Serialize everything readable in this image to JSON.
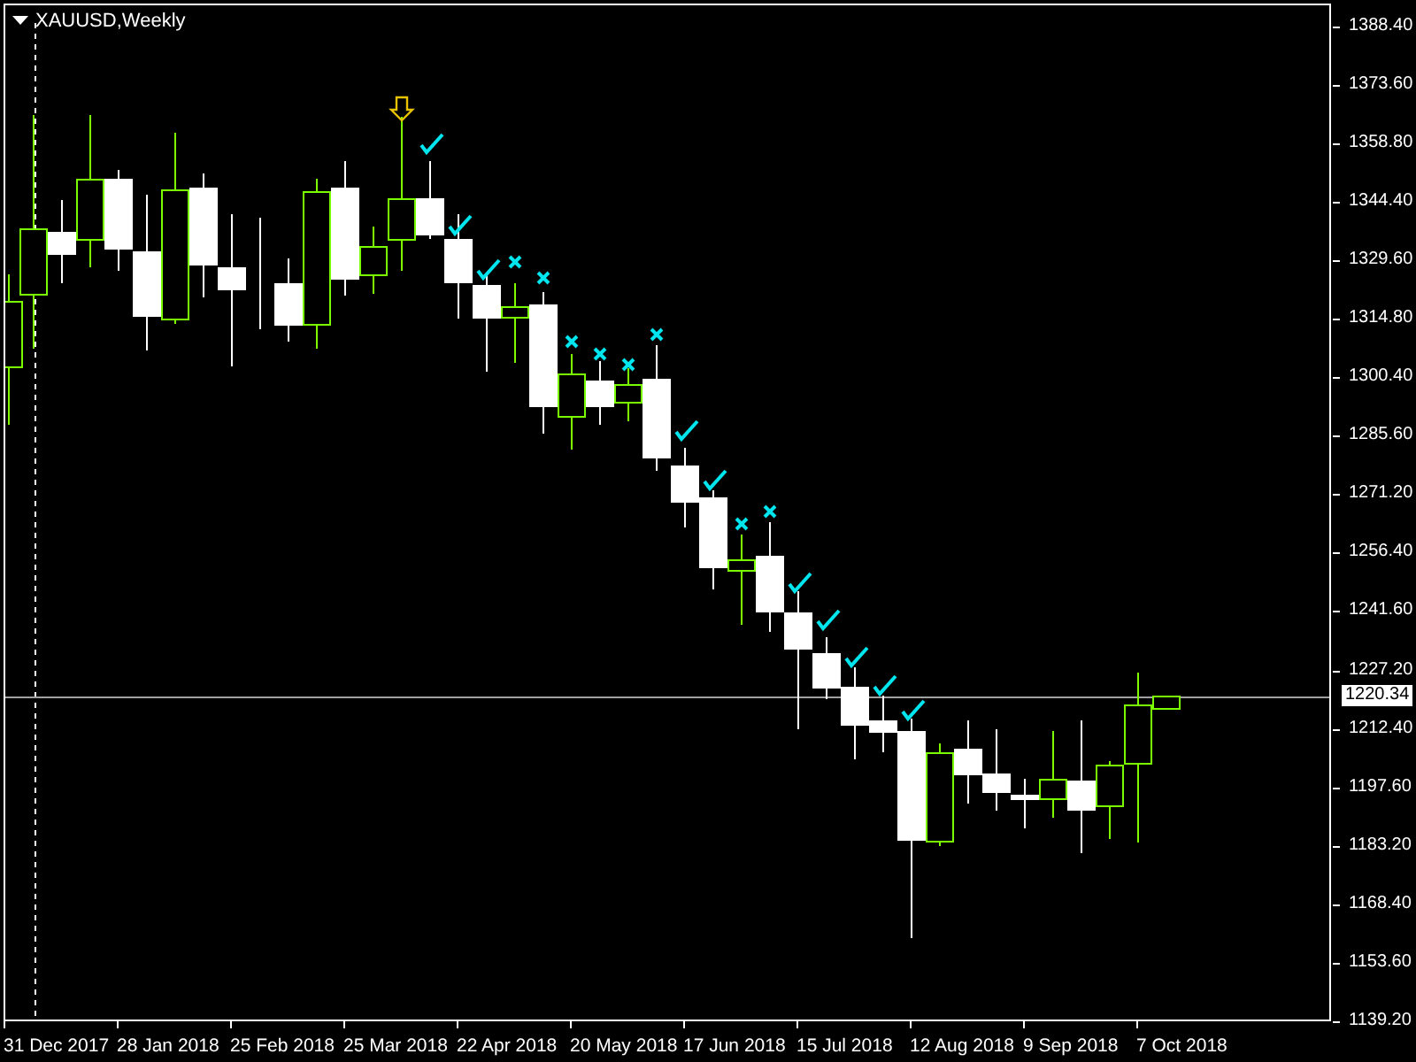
{
  "chart": {
    "symbol": "XAUUSD,Weekly",
    "price_labels": [
      "1388.40",
      "1373.60",
      "1358.80",
      "1344.40",
      "1329.60",
      "1314.80",
      "1300.40",
      "1285.60",
      "1271.20",
      "1256.40",
      "1241.60",
      "1227.20",
      "1212.40",
      "1197.60",
      "1183.20",
      "1168.40",
      "1153.60",
      "1139.20"
    ],
    "current_price": "1220.34",
    "date_labels": [
      "31 Dec 2017",
      "28 Jan 2018",
      "25 Feb 2018",
      "25 Mar 2018",
      "22 Apr 2018",
      "20 May 2018",
      "17 Jun 2018",
      "15 Jul 2018",
      "12 Aug 2018",
      "9 Sep 2018",
      "7 Oct 2018"
    ]
  }
}
